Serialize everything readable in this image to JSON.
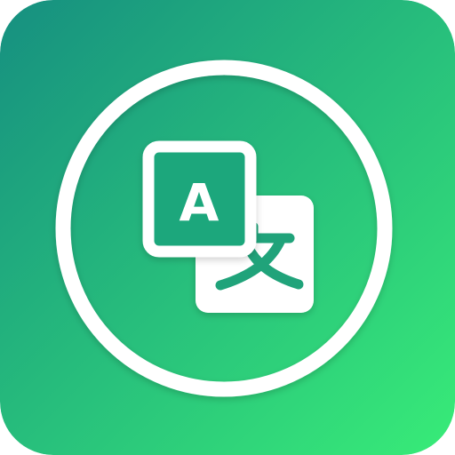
{
  "icon": {
    "name": "translate-app-icon",
    "gradient_start": "#168f80",
    "gradient_end": "#38ec78",
    "ring_color": "#ffffff",
    "card_fill": "#ffffff",
    "card_text_color": "#20a37a",
    "front_card_fill": "#1fa77c",
    "front_card_border": "#ffffff",
    "latin_glyph": "A",
    "cjk_glyph": "文"
  }
}
